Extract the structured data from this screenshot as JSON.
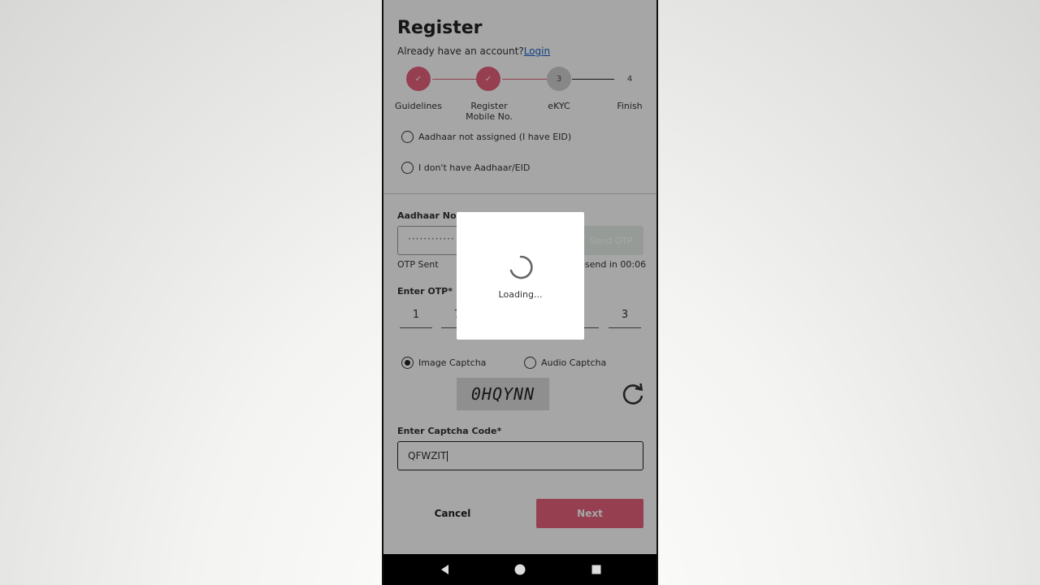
{
  "register": {
    "title": "Register",
    "subtitle_prefix": "Already have an account?",
    "login_link": "Login"
  },
  "steps": [
    {
      "label": "Guidelines",
      "state": "done",
      "marker": "✓"
    },
    {
      "label": "Register Mobile No.",
      "state": "done",
      "marker": "✓"
    },
    {
      "label": "eKYC",
      "state": "current",
      "marker": "3"
    },
    {
      "label": "Finish",
      "state": "todo",
      "marker": "4"
    }
  ],
  "options": {
    "aadhaar_not_assigned": "Aadhaar not assigned (I have EID)",
    "no_aadhaar": "I don't have Aadhaar/EID"
  },
  "aadhaar": {
    "label": "Aadhaar No.*",
    "value": "············",
    "otp_button": "Send OTP",
    "otp_sent": "OTP Sent",
    "resend": "Resend in 00:06"
  },
  "otp": {
    "label": "Enter OTP*",
    "first_digit": "1",
    "second_digit": "7",
    "last_digit": "3"
  },
  "captcha": {
    "image_option": "Image Captcha",
    "audio_option": "Audio Captcha",
    "image_text": "0HQYNN",
    "input_label": "Enter Captcha Code*",
    "input_value": "QFWZIT"
  },
  "actions": {
    "cancel": "Cancel",
    "next": "Next"
  },
  "loading": {
    "text": "Loading..."
  },
  "colors": {
    "accent": "#e5627d",
    "link": "#1a63c8"
  }
}
